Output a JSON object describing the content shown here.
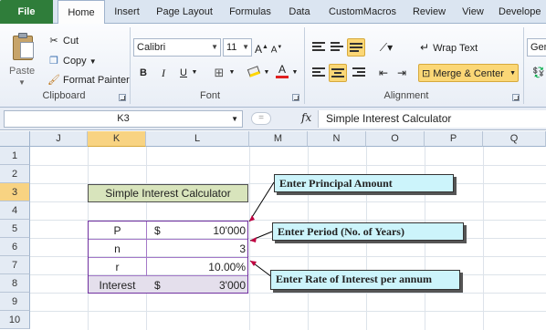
{
  "ribbon_tabs": [
    "File",
    "Home",
    "Insert",
    "Page Layout",
    "Formulas",
    "Data",
    "CustomMacros",
    "Review",
    "View",
    "Develope"
  ],
  "clipboard": {
    "paste_label": "Paste",
    "cut_label": "Cut",
    "copy_label": "Copy",
    "format_painter_label": "Format Painter",
    "group_label": "Clipboard"
  },
  "font": {
    "font_name": "Calibri",
    "font_size": "11",
    "bold": "B",
    "italic": "I",
    "underline": "U",
    "grow": "A",
    "shrink": "A",
    "font_color_glyph": "A",
    "group_label": "Font"
  },
  "alignment": {
    "wrap_text_label": "Wrap Text",
    "merge_center_label": "Merge & Center",
    "group_label": "Alignment"
  },
  "number": {
    "format_label": "Gen"
  },
  "formula_bar": {
    "name_box": "K3",
    "fx_label": "fx",
    "content": "Simple Interest Calculator"
  },
  "columns": [
    "J",
    "K",
    "L",
    "M",
    "N",
    "O",
    "P",
    "Q"
  ],
  "rows": [
    "1",
    "2",
    "3",
    "4",
    "5",
    "6",
    "7",
    "8",
    "9",
    "10"
  ],
  "selected": {
    "column": "K",
    "row": "3"
  },
  "sheet": {
    "title": "Simple Interest Calculator",
    "table": [
      {
        "label": "P",
        "currency": "$",
        "value": "10'000"
      },
      {
        "label": "n",
        "currency": "",
        "value": "3"
      },
      {
        "label": "r",
        "currency": "",
        "value": "10.00%"
      },
      {
        "label": "Interest",
        "currency": "$",
        "value": "3'000"
      }
    ]
  },
  "callouts": {
    "principal": "Enter Principal Amount",
    "period": "Enter Period (No. of Years)",
    "rate": "Enter Rate of Interest per annum"
  },
  "colors": {
    "file_tab": "#2f7d3a",
    "title_fill": "#d8e4bc",
    "table_border": "#7030a0",
    "callout_fill": "#ccf4fb",
    "selection_header": "#f8d382",
    "highlight_button": "#fbd776"
  }
}
